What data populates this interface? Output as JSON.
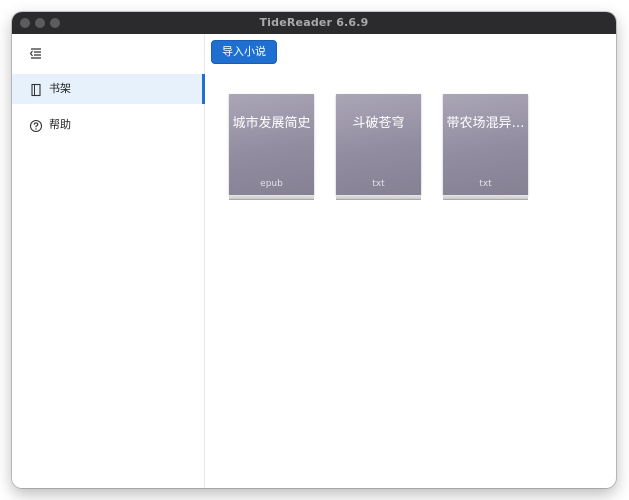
{
  "window": {
    "title": "TideReader 6.6.9"
  },
  "sidebar": {
    "items": [
      {
        "label": "书架",
        "icon": "book-icon",
        "active": true
      },
      {
        "label": "帮助",
        "icon": "help-circle-icon",
        "active": false
      }
    ]
  },
  "toolbar": {
    "import_label": "导入小说"
  },
  "books": [
    {
      "title": "城市发展简史",
      "format": "epub"
    },
    {
      "title": "斗破苍穹",
      "format": "txt"
    },
    {
      "title": "带农场混异…",
      "format": "txt"
    }
  ],
  "colors": {
    "accent": "#1f6fd1",
    "active_bg": "#e6f1fb",
    "cover": "#928ca0"
  }
}
